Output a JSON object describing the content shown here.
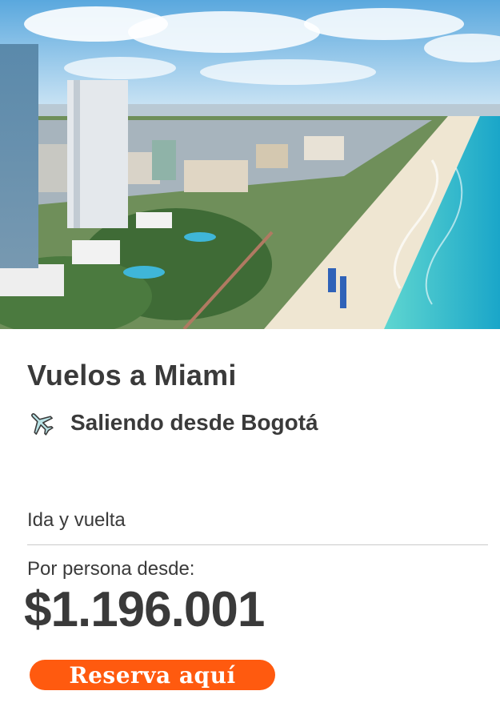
{
  "hero": {
    "image_alt_icon": "beach-city-photo"
  },
  "title": "Vuelos a Miami",
  "origin": {
    "icon": "airplane-icon",
    "text": "Saliendo desde Bogotá"
  },
  "trip_type": "Ida y vuelta",
  "price_label": "Por persona desde:",
  "price": "$1.196.001",
  "cta_label": "Reserva aquí",
  "colors": {
    "cta": "#ff5a0f",
    "text": "#3a3a3a"
  }
}
